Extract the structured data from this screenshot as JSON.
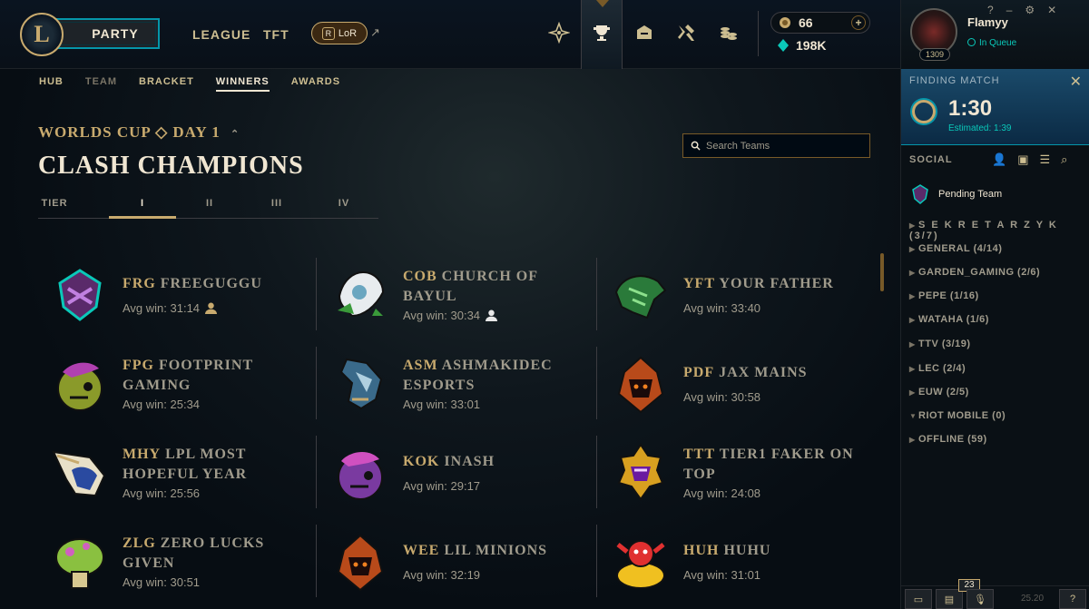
{
  "topbar": {
    "party_label": "PARTY",
    "nav": [
      "LEAGUE",
      "TFT"
    ],
    "lor_label": "LoR",
    "currency": {
      "rp": "66",
      "be": "198K"
    }
  },
  "subnav": {
    "items": [
      "HUB",
      "TEAM",
      "BRACKET",
      "WINNERS",
      "AWARDS"
    ],
    "active": "WINNERS"
  },
  "page": {
    "crumb": "WORLDS CUP ◇ DAY 1",
    "title": "CLASH CHAMPIONS",
    "search_placeholder": "Search Teams",
    "tier_label": "TIER",
    "tiers": [
      "I",
      "II",
      "III",
      "IV"
    ]
  },
  "teams": [
    {
      "tag": "FRG",
      "name": "FREEGUGGU",
      "avg": "Avg win: 31:14",
      "icon": "person-icon-gold"
    },
    {
      "tag": "COB",
      "name": "CHURCH OF BAYUL",
      "avg": "Avg win: 30:34",
      "icon": "person-icon-white"
    },
    {
      "tag": "YFT",
      "name": "YOUR FATHER",
      "avg": "Avg win: 33:40"
    },
    {
      "tag": "FPG",
      "name": "FOOTPRINT GAMING",
      "avg": "Avg win: 25:34"
    },
    {
      "tag": "ASM",
      "name": "ASHMAKIDEC ESPORTS",
      "avg": "Avg win: 33:01"
    },
    {
      "tag": "PDF",
      "name": "JAX MAINS",
      "avg": "Avg win: 30:58"
    },
    {
      "tag": "MHY",
      "name": "LPL MOST HOPEFUL YEAR",
      "avg": "Avg win: 25:56"
    },
    {
      "tag": "KOK",
      "name": "INASH",
      "avg": "Avg win: 29:17"
    },
    {
      "tag": "TTT",
      "name": "TIER1 FAKER ON TOP",
      "avg": "Avg win: 24:08"
    },
    {
      "tag": "ZLG",
      "name": "ZERO LUCKS GIVEN",
      "avg": "Avg win: 30:51"
    },
    {
      "tag": "WEE",
      "name": "LIL MINIONS",
      "avg": "Avg win: 32:19"
    },
    {
      "tag": "HUH",
      "name": "HUHU",
      "avg": "Avg win: 31:01"
    }
  ],
  "profile": {
    "name": "Flamyy",
    "status": "In Queue",
    "level": "1309"
  },
  "finding": {
    "label": "FINDING MATCH",
    "time": "1:30",
    "estimated": "Estimated: 1:39"
  },
  "social": {
    "label": "SOCIAL",
    "pending": "Pending Team",
    "groups": [
      "S E K R E T A R Z Y K (3/7)",
      "GENERAL (4/14)",
      "GARDEN_GAMING (2/6)",
      "PEPE (1/16)",
      "WATAHA (1/6)",
      "TTV (3/19)",
      "LEC (2/4)",
      "EUW (2/5)",
      "RIOT MOBILE (0)",
      "OFFLINE (59)"
    ]
  },
  "bottom": {
    "badge": "23",
    "version": "25.20"
  },
  "colors": {
    "gold": "#c8aa6e",
    "teal": "#0ac8b9",
    "bg": "#010a13"
  }
}
